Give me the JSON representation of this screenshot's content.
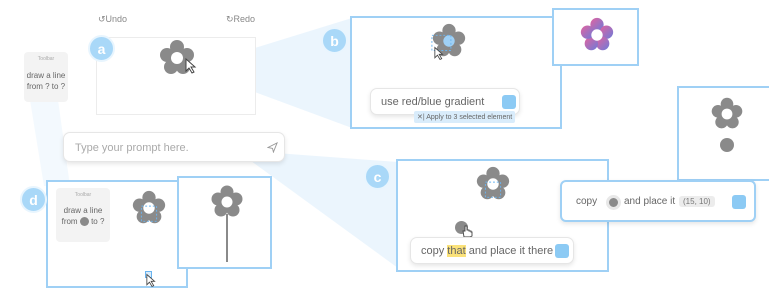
{
  "toolbar_top": {
    "undo": "Undo",
    "redo": "Redo"
  },
  "badges": {
    "a": "a",
    "b": "b",
    "c": "c",
    "d": "d"
  },
  "toolbar_a": {
    "label": "Toolbar",
    "line1": "draw a line",
    "line2": "from ? to ?"
  },
  "main_prompt": {
    "placeholder": "Type your prompt here."
  },
  "panel_b": {
    "prompt": "use red/blue gradient",
    "apply": "Apply to 3 selected element"
  },
  "panel_c": {
    "prompt_before": "copy ",
    "prompt_highlight": "that",
    "prompt_after": " and place it there"
  },
  "panel_c_zoom": {
    "word1": "copy",
    "word2": "and place it",
    "coords": "(15, 10)"
  },
  "toolbar_d": {
    "label": "Toolbar",
    "line1": "draw a line",
    "line2_before": "from",
    "line2_after": "to ?"
  },
  "colors": {
    "accent": "#9fd0f5",
    "flower": "#8a8a8a",
    "highlight": "#fbe27a"
  },
  "icons": [
    "undo-icon",
    "redo-icon",
    "send-icon",
    "cursor-icon",
    "hand-cursor-icon",
    "flower-icon",
    "close-icon"
  ]
}
